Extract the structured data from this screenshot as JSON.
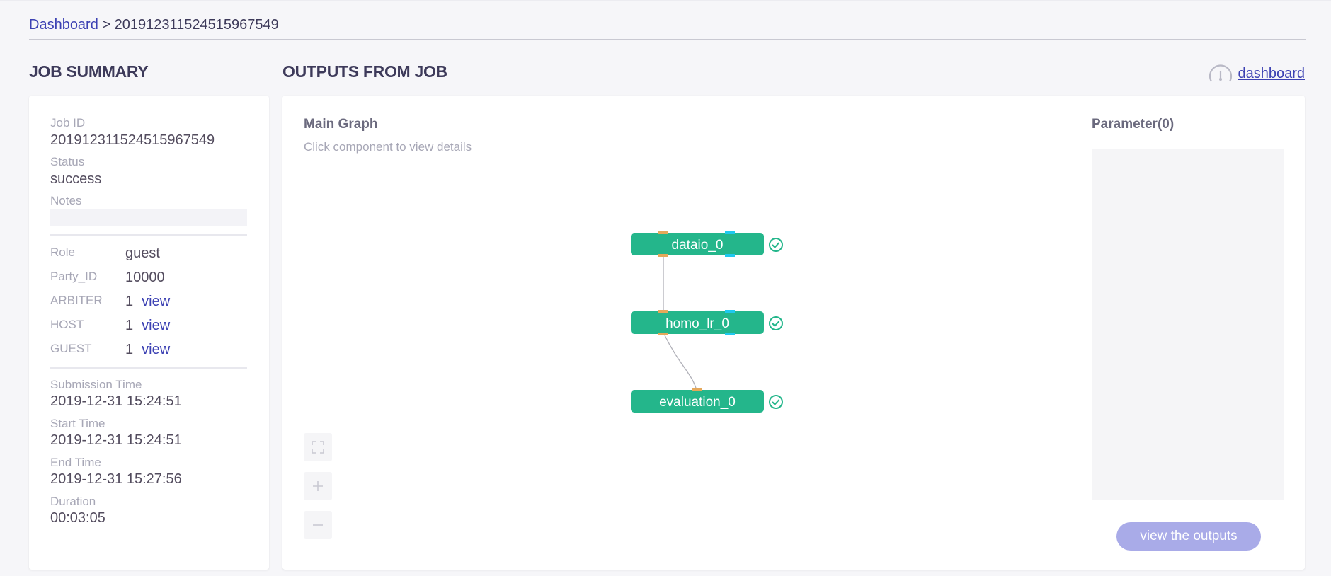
{
  "breadcrumb": {
    "root": "Dashboard",
    "separator": " > ",
    "current": "201912311524515967549"
  },
  "headings": {
    "job_summary": "JOB SUMMARY",
    "outputs": "OUTPUTS FROM JOB",
    "dashboard_link": "dashboard"
  },
  "summary": {
    "job_id_label": "Job ID",
    "job_id": "201912311524515967549",
    "status_label": "Status",
    "status": "success",
    "notes_label": "Notes",
    "notes": "",
    "roles": [
      {
        "label": "Role",
        "value": "guest",
        "link": ""
      },
      {
        "label": "Party_ID",
        "value": "10000",
        "link": ""
      },
      {
        "label": "ARBITER",
        "value": "1",
        "link": "view"
      },
      {
        "label": "HOST",
        "value": "1",
        "link": "view"
      },
      {
        "label": "GUEST",
        "value": "1",
        "link": "view"
      }
    ],
    "submission_label": "Submission Time",
    "submission": "2019-12-31 15:24:51",
    "start_label": "Start Time",
    "start": "2019-12-31 15:24:51",
    "end_label": "End Time",
    "end": "2019-12-31 15:27:56",
    "duration_label": "Duration",
    "duration": "00:03:05"
  },
  "graph": {
    "title": "Main Graph",
    "subtitle": "Click component to view details",
    "nodes": [
      {
        "name": "dataio_0",
        "status": "success"
      },
      {
        "name": "homo_lr_0",
        "status": "success"
      },
      {
        "name": "evaluation_0",
        "status": "success"
      }
    ],
    "colors": {
      "node": "#24b68b",
      "port_data": "#e5a85a",
      "port_model": "#1fc9ef",
      "check": "#24b68b"
    },
    "controls": [
      "fullscreen-icon",
      "zoom-in-icon",
      "zoom-out-icon"
    ]
  },
  "parameters": {
    "title": "Parameter(0)"
  },
  "buttons": {
    "view_outputs": "view the outputs"
  }
}
